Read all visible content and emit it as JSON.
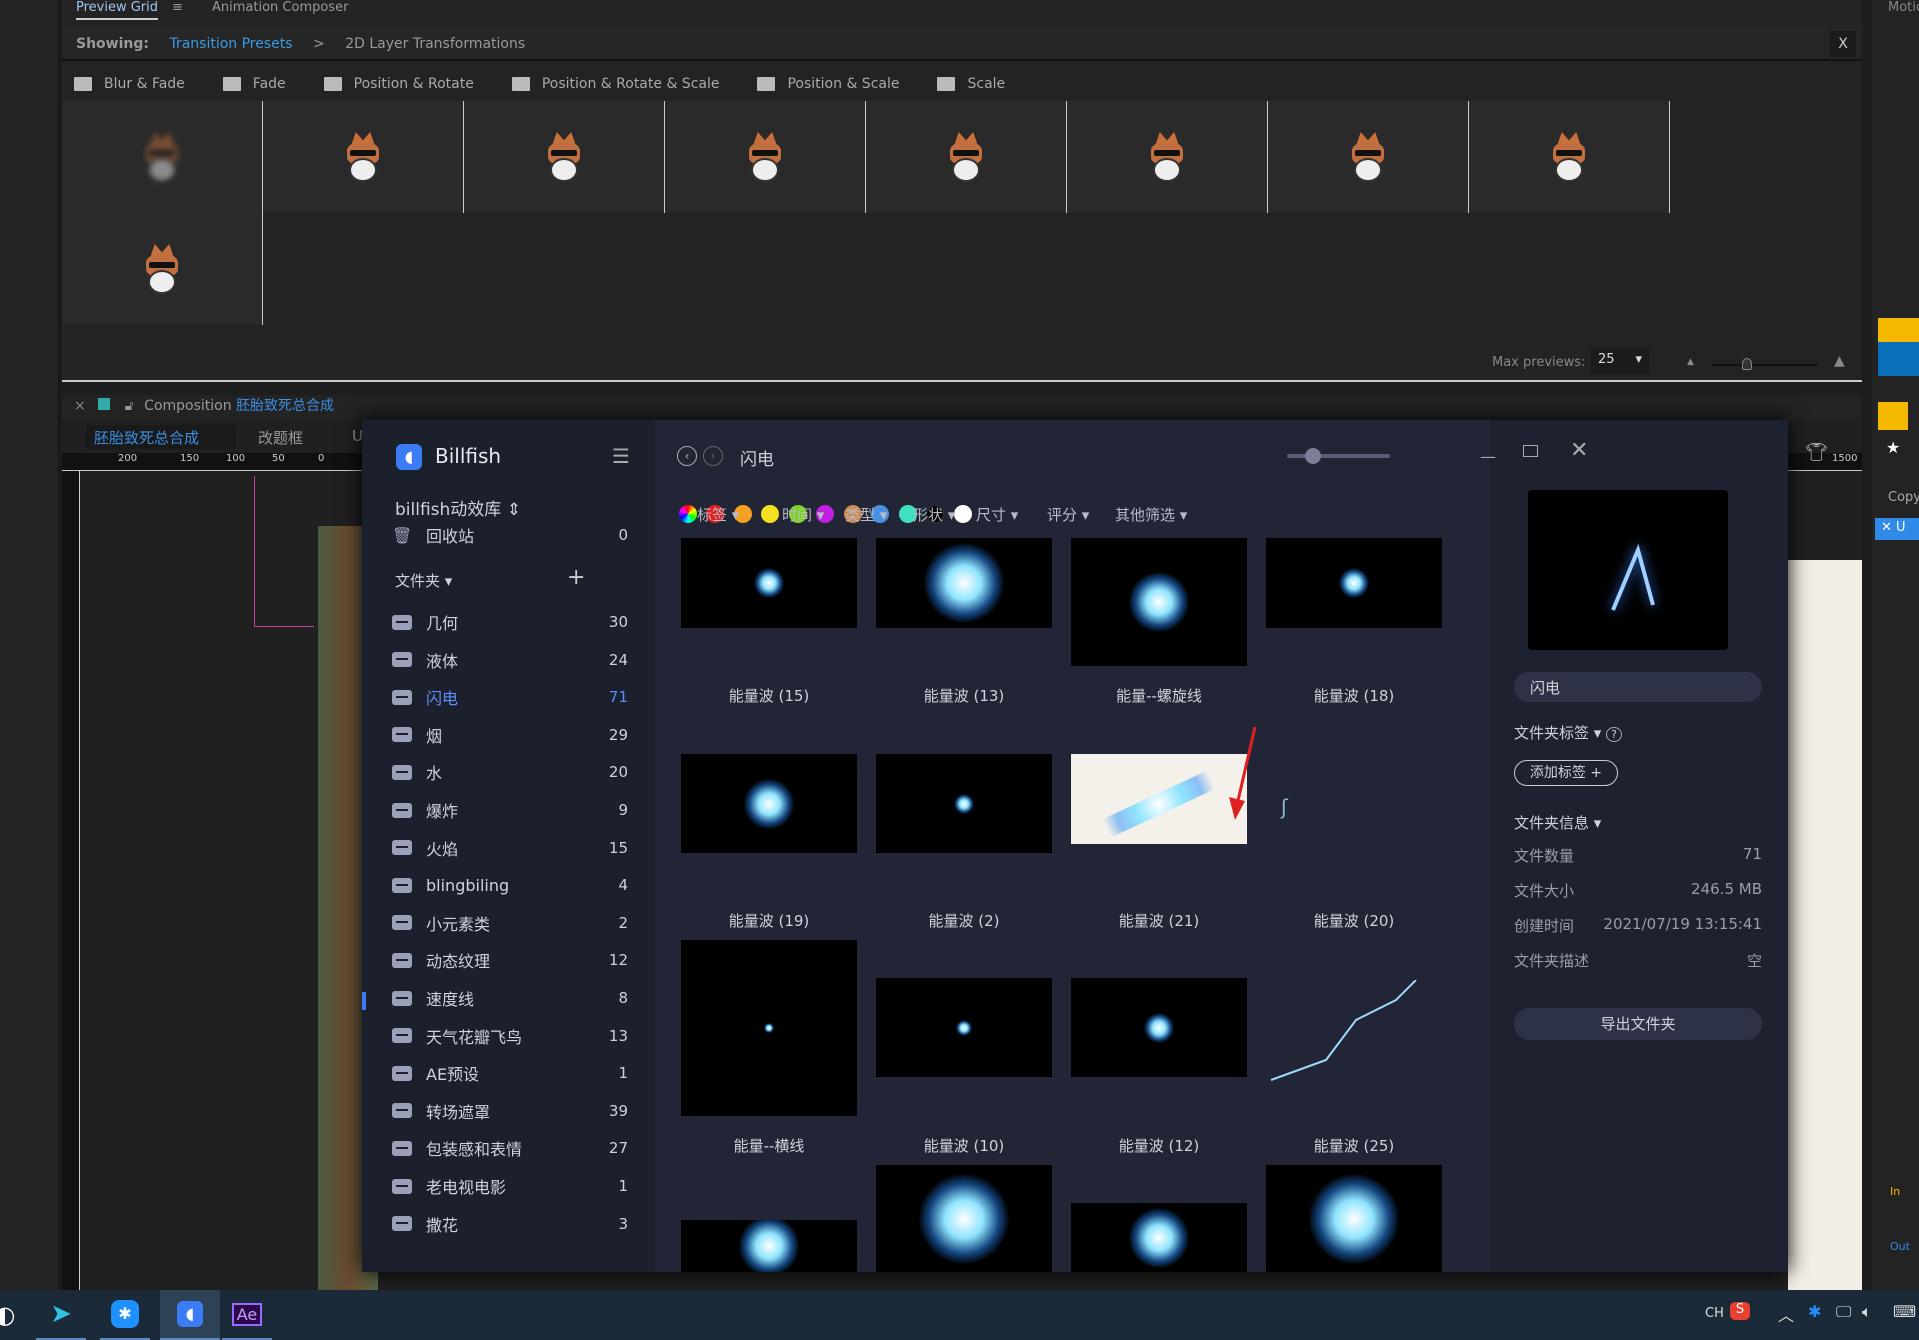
{
  "ae": {
    "tabs": [
      "Preview Grid",
      "Animation Composer"
    ],
    "showing_label": "Showing:",
    "breadcrumb_root": "Transition Presets",
    "breadcrumb_sep": ">",
    "breadcrumb_current": "2D Layer Transformations",
    "close": "X",
    "folders": [
      "Blur & Fade",
      "Fade",
      "Position & Rotate",
      "Position & Rotate & Scale",
      "Position & Scale",
      "Scale"
    ],
    "max_previews_label": "Max previews:",
    "max_previews_value": "25",
    "composition_label": "Composition",
    "composition_name": "胚胎致死总合成",
    "comp_tabs": [
      "胚胎致死总合成",
      "改题框",
      "Ur"
    ],
    "ruler_ticks": [
      "200",
      "150",
      "100",
      "50",
      "0",
      "1500"
    ],
    "right_panel": {
      "motion": "Motio",
      "copy": "Copy",
      "up": "U",
      "in": "In",
      "out": "Out"
    }
  },
  "billfish": {
    "app_name": "Billfish",
    "library": "billfish动效库 ⇕",
    "recycle": {
      "label": "回收站",
      "count": "0"
    },
    "folders_header": "文件夹 ▾",
    "folders": [
      {
        "label": "几何",
        "count": "30"
      },
      {
        "label": "液体",
        "count": "24"
      },
      {
        "label": "闪电",
        "count": "71",
        "active": true
      },
      {
        "label": "烟",
        "count": "29"
      },
      {
        "label": "水",
        "count": "20"
      },
      {
        "label": "爆炸",
        "count": "9"
      },
      {
        "label": "火焰",
        "count": "15"
      },
      {
        "label": "blingbiling",
        "count": "4"
      },
      {
        "label": "小元素类",
        "count": "2"
      },
      {
        "label": "动态纹理",
        "count": "12"
      },
      {
        "label": "速度线",
        "count": "8"
      },
      {
        "label": "天气花瓣飞鸟",
        "count": "13"
      },
      {
        "label": "AE预设",
        "count": "1"
      },
      {
        "label": "转场遮罩",
        "count": "39"
      },
      {
        "label": "包装感和表情",
        "count": "27"
      },
      {
        "label": "老电视电影",
        "count": "1"
      },
      {
        "label": "撒花",
        "count": "3"
      }
    ],
    "current_folder": "闪电",
    "colors": [
      "#e02020",
      "#f5a020",
      "#f5e020",
      "#7ed321",
      "#c020e0",
      "#d08850",
      "#4a90e2",
      "#40e0c0",
      "#000000",
      "#ffffff"
    ],
    "filters": [
      "标签 ▾",
      "时间 ▾",
      "类型 ▾",
      "形状 ▾",
      "尺寸 ▾",
      "评分 ▾",
      "其他筛选 ▾"
    ],
    "items": [
      {
        "name": "能量波 (15)"
      },
      {
        "name": "能量波 (13)"
      },
      {
        "name": "能量--螺旋线"
      },
      {
        "name": "能量波 (18)"
      },
      {
        "name": "能量波 (19)"
      },
      {
        "name": "能量波 (2)"
      },
      {
        "name": "能量波 (21)"
      },
      {
        "name": "能量波 (20)"
      },
      {
        "name": "能量--横线"
      },
      {
        "name": "能量波 (10)"
      },
      {
        "name": "能量波 (12)"
      },
      {
        "name": "能量波 (25)"
      }
    ],
    "detail": {
      "name": "闪电",
      "tags_header": "文件夹标签 ▾",
      "add_tag": "添加标签 +",
      "info_header": "文件夹信息 ▾",
      "rows": [
        {
          "k": "文件数量",
          "v": "71"
        },
        {
          "k": "文件大小",
          "v": "246.5 MB"
        },
        {
          "k": "创建时间",
          "v": "2021/07/19 13:15:41"
        },
        {
          "k": "文件夹描述",
          "v": "空"
        }
      ],
      "export": "导出文件夹"
    }
  },
  "taskbar": {
    "ime": "CH",
    "ae_icon": "Ae"
  }
}
